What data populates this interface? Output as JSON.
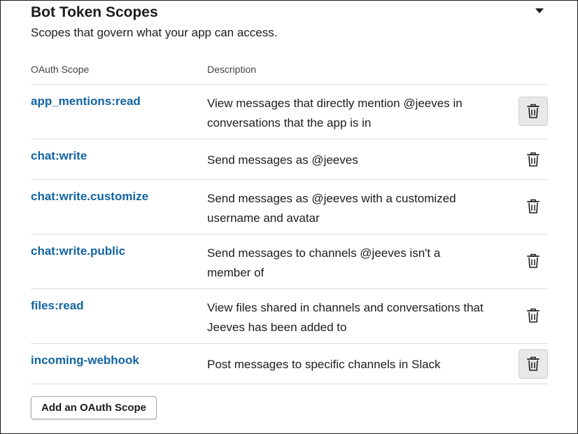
{
  "section": {
    "title": "Bot Token Scopes",
    "subtitle": "Scopes that govern what your app can access."
  },
  "table": {
    "headers": {
      "scope": "OAuth Scope",
      "description": "Description"
    },
    "rows": [
      {
        "scope": "app_mentions:read",
        "description": "View messages that directly mention @jeeves in conversations that the app is in"
      },
      {
        "scope": "chat:write",
        "description": "Send messages as @jeeves"
      },
      {
        "scope": "chat:write.customize",
        "description": "Send messages as @jeeves with a customized username and avatar"
      },
      {
        "scope": "chat:write.public",
        "description": "Send messages to channels @jeeves isn't a member of"
      },
      {
        "scope": "files:read",
        "description": "View files shared in channels and conversations that Jeeves has been added to"
      },
      {
        "scope": "incoming-webhook",
        "description": "Post messages to specific channels in Slack"
      }
    ]
  },
  "actions": {
    "add_scope_label": "Add an OAuth Scope"
  },
  "icons": {
    "delete": "trash-icon",
    "collapse": "caret-down-icon"
  },
  "colors": {
    "link": "#1264a3",
    "text": "#1d1c1d",
    "divider": "#dddddd"
  }
}
